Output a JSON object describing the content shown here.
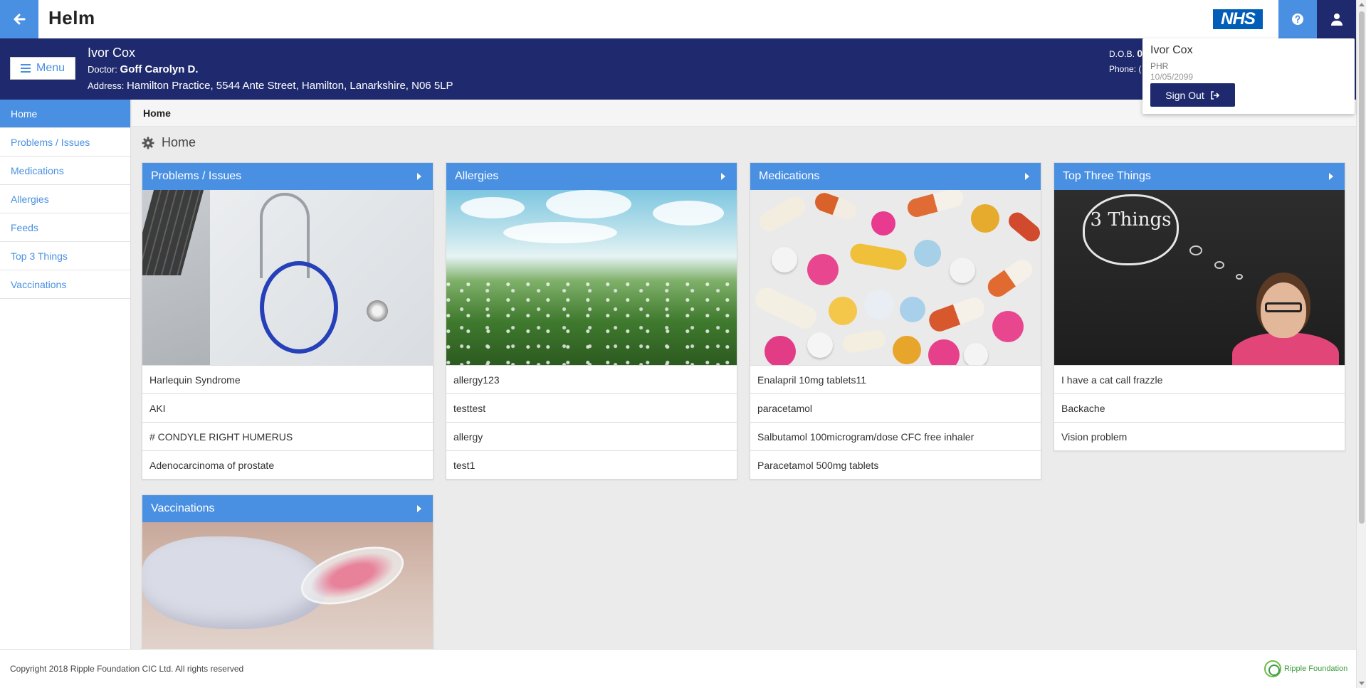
{
  "app": {
    "logo": "Helm",
    "nhs_logo": "NHS"
  },
  "banner": {
    "menu_label": "Menu",
    "patient_name": "Ivor Cox",
    "doctor_label": "Doctor:",
    "doctor_name": "Goff Carolyn D.",
    "address_label": "Address:",
    "address": "Hamilton Practice, 5544 Ante Street, Hamilton, Lanarkshire, N06 5LP",
    "dob_label": "D.O.B.",
    "dob_value": "0",
    "phone_label": "Phone:",
    "phone_value": "("
  },
  "user_popover": {
    "name": "Ivor Cox",
    "role": "PHR",
    "date": "10/05/2099",
    "signout_label": "Sign Out"
  },
  "sidebar": {
    "items": [
      {
        "label": "Home",
        "active": true
      },
      {
        "label": "Problems / Issues"
      },
      {
        "label": "Medications"
      },
      {
        "label": "Allergies"
      },
      {
        "label": "Feeds"
      },
      {
        "label": "Top 3 Things"
      },
      {
        "label": "Vaccinations"
      }
    ]
  },
  "main": {
    "breadcrumb": "Home",
    "page_title": "Home",
    "cards": [
      {
        "title": "Problems / Issues",
        "rows": [
          "Harlequin Syndrome",
          "AKI",
          "# CONDYLE RIGHT HUMERUS",
          "Adenocarcinoma of prostate"
        ]
      },
      {
        "title": "Allergies",
        "rows": [
          "allergy123",
          "testtest",
          "allergy",
          "test1"
        ]
      },
      {
        "title": "Medications",
        "rows": [
          "Enalapril 10mg tablets11",
          "paracetamol",
          "Salbutamol 100microgram/dose CFC free inhaler",
          "Paracetamol 500mg tablets"
        ]
      },
      {
        "title": "Top Three Things",
        "rows": [
          "I have a cat call frazzle",
          "Backache",
          "Vision problem"
        ],
        "image_text": "3 Things"
      },
      {
        "title": "Vaccinations",
        "rows": []
      }
    ]
  },
  "footer": {
    "copyright": "Copyright 2018 Ripple Foundation CIC Ltd. All rights reserved",
    "brand": "Ripple Foundation"
  },
  "colors": {
    "primary_blue": "#4a90e2",
    "navy": "#1f2a6e",
    "nhs_blue": "#005eb8"
  }
}
